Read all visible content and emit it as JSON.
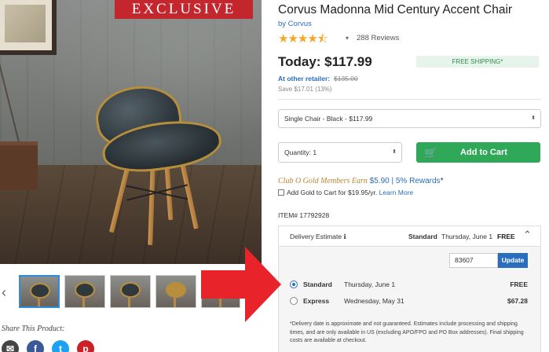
{
  "hero": {
    "badge": "EXCLUSIVE"
  },
  "thumbnails": {
    "prev_arrow": "‹",
    "count_visible": 5,
    "active_index": 0
  },
  "share": {
    "label": "Share This Product:",
    "icons": [
      "email-icon",
      "facebook-icon",
      "twitter-icon",
      "pinterest-icon"
    ]
  },
  "product": {
    "title": "Corvus Madonna Mid Century Accent Chair",
    "brand": "by Corvus",
    "rating": 4.5,
    "stars": "★★★★⯪",
    "review_caret": "▾",
    "reviews": "288 Reviews",
    "today_price": "Today: $117.99",
    "free_shipping": "FREE SHIPPING*",
    "other_retailer_label": "At other retailer:",
    "other_retailer_price": "$135.00",
    "save": "Save $17.01 (13%)",
    "item_number": "ITEM# 17792928"
  },
  "variant_select": {
    "value": "Single Chair - Black - $117.99",
    "chevron": "⬍"
  },
  "quantity_select": {
    "value": "Quantity: 1",
    "chevron": "⬍"
  },
  "cart": {
    "icon": "🛒",
    "label": "Add to Cart"
  },
  "club": {
    "members_text": "Club O Gold Members Earn",
    "reward_amount": "$5.90",
    "separator": " | ",
    "rewards": "5% Rewards",
    "asterisk": "*",
    "add_gold_text": "Add Gold to Cart for $19.95/yr.",
    "learn_more": "Learn More"
  },
  "delivery": {
    "label": "Delivery Estimate ℹ",
    "selected_method": "Standard",
    "selected_date": "Thursday, June 1",
    "selected_price": "FREE",
    "caret": "⌃",
    "zip": "83607",
    "update_label": "Update",
    "options": [
      {
        "name": "Standard",
        "date": "Thursday, June 1",
        "price": "FREE",
        "selected": true
      },
      {
        "name": "Express",
        "date": "Wednesday, May 31",
        "price": "$67.28",
        "selected": false
      }
    ],
    "note": "*Delivery date is approximate and not guaranteed. Estimates include processing and shipping times, and are only available in US (excluding APO/FPO and PO Box addresses). Final shipping costs are available at checkout."
  },
  "colors": {
    "badge_red": "#c4262e",
    "link_blue": "#2a6ebb",
    "cart_green": "#2fa957",
    "star_gold": "#f5a623",
    "arrow_red": "#e8232a"
  }
}
